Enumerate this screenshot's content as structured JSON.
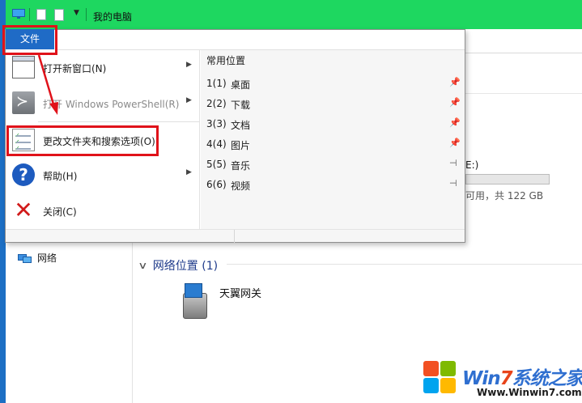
{
  "window": {
    "title": "我的电脑"
  },
  "file_menu": {
    "tab_label": "文件",
    "items": [
      {
        "label": "打开新窗口(N)",
        "icon": "new-window-icon",
        "has_submenu": true,
        "enabled": true
      },
      {
        "label": "打开 Windows PowerShell(R)",
        "icon": "powershell-icon",
        "has_submenu": true,
        "enabled": false
      },
      {
        "label": "更改文件夹和搜索选项(O)",
        "icon": "folder-options-icon",
        "has_submenu": false,
        "enabled": true
      },
      {
        "label": "帮助(H)",
        "icon": "help-icon",
        "has_submenu": true,
        "enabled": true
      },
      {
        "label": "关闭(C)",
        "icon": "close-icon",
        "has_submenu": false,
        "enabled": true
      }
    ]
  },
  "frequent_places": {
    "header": "常用位置",
    "items": [
      {
        "num": "1(1)",
        "name": "桌面",
        "pin": "pinned"
      },
      {
        "num": "2(2)",
        "name": "下载",
        "pin": "pinned"
      },
      {
        "num": "3(3)",
        "name": "文档",
        "pin": "pinned"
      },
      {
        "num": "4(4)",
        "name": "图片",
        "pin": "pinned"
      },
      {
        "num": "5(5)",
        "name": "音乐",
        "pin": "unpinned"
      },
      {
        "num": "6(6)",
        "name": "视频",
        "pin": "unpinned"
      }
    ]
  },
  "nav_pane": {
    "network": "网络"
  },
  "content": {
    "drive_label": "E:)",
    "drive_free": "可用，共 122 GB",
    "drive_usage_fraction": 0.0,
    "network_group": "网络位置 (1)",
    "network_device": "天翼网关"
  },
  "watermark": {
    "brand_prefix": "Win",
    "brand_seven": "7",
    "brand_suffix": "系统之家",
    "url": "Www.Winwin7.com"
  },
  "colors": {
    "titlebar": "#1ed760",
    "file_tab": "#1f6bc6",
    "annotation": "#e0121a"
  }
}
